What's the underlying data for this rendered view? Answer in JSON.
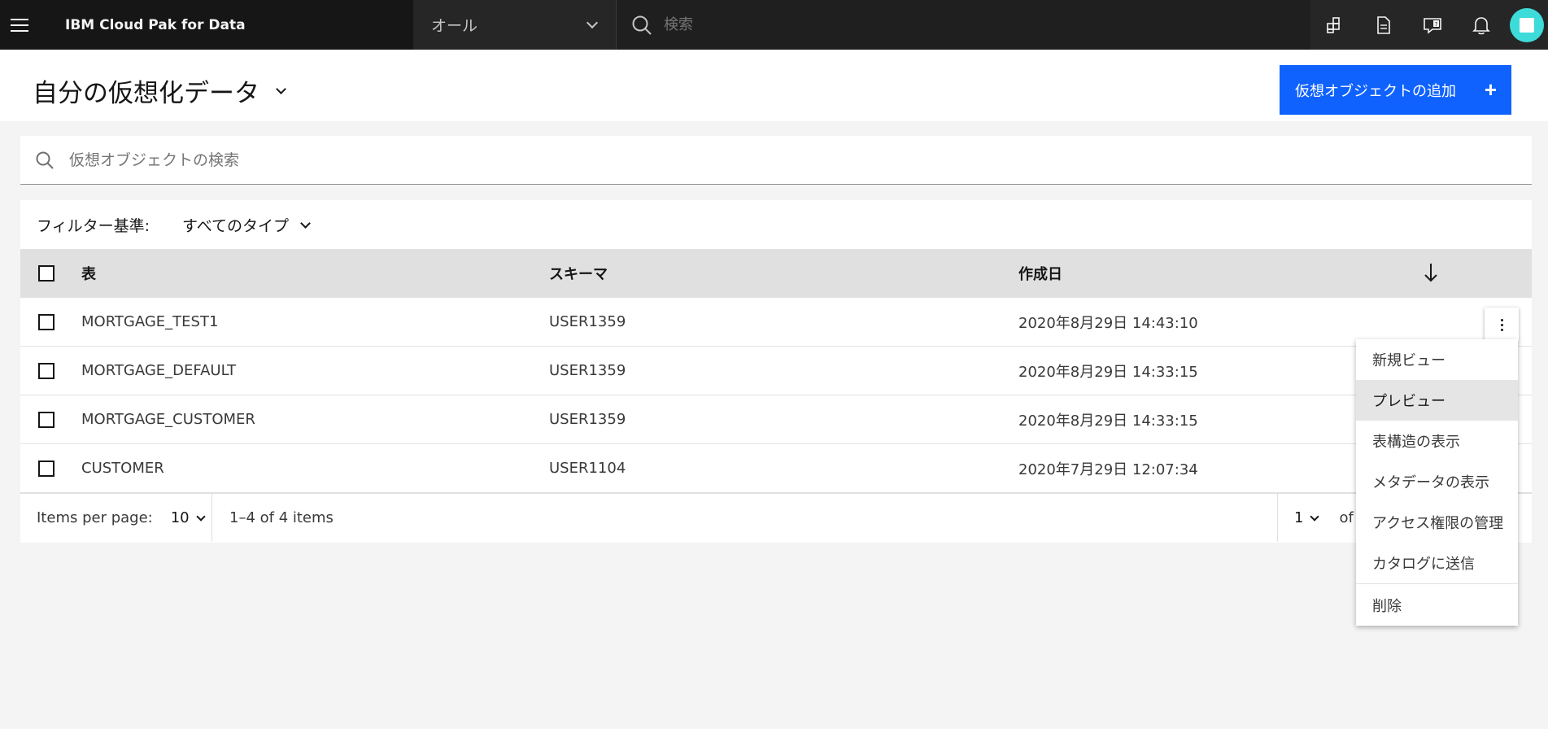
{
  "header": {
    "app_name": "IBM Cloud Pak for Data",
    "scope_selector": "オール",
    "search_placeholder": "検索"
  },
  "page": {
    "title": "自分の仮想化データ",
    "add_button_label": "仮想オブジェクトの追加",
    "add_button_icon": "+"
  },
  "object_search": {
    "placeholder": "仮想オブジェクトの検索"
  },
  "filter": {
    "label": "フィルター基準:",
    "selected": "すべてのタイプ"
  },
  "table": {
    "columns": [
      "表",
      "スキーマ",
      "作成日"
    ],
    "rows": [
      {
        "table": "MORTGAGE_TEST1",
        "schema": "USER1359",
        "created": "2020年8月29日 14:43:10"
      },
      {
        "table": "MORTGAGE_DEFAULT",
        "schema": "USER1359",
        "created": "2020年8月29日 14:33:15"
      },
      {
        "table": "MORTGAGE_CUSTOMER",
        "schema": "USER1359",
        "created": "2020年8月29日 14:33:15"
      },
      {
        "table": "CUSTOMER",
        "schema": "USER1104",
        "created": "2020年7月29日 12:07:34"
      }
    ]
  },
  "pagination": {
    "items_per_page_label": "Items per page:",
    "items_per_page_value": "10",
    "range_text": "1–4 of 4 items",
    "current_page": "1",
    "of_text": "of"
  },
  "overflow_menu": {
    "items": [
      "新規ビュー",
      "プレビュー",
      "表構造の表示",
      "メタデータの表示",
      "アクセス権限の管理",
      "カタログに送信",
      "削除"
    ]
  },
  "colors": {
    "header_bg": "#161616",
    "primary_button": "#0f62fe",
    "avatar": "#3ddbd9",
    "table_header_bg": "#e0e0e0"
  }
}
